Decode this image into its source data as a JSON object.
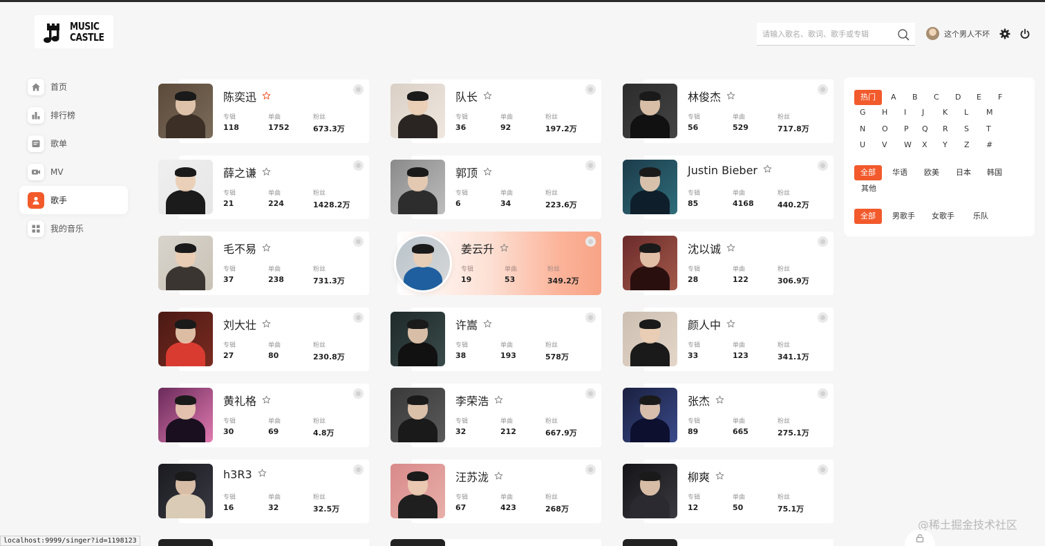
{
  "header": {
    "logo_line1": "MUSIC",
    "logo_line2": "CASTLE",
    "search_placeholder": "请输入歌名、歌词、歌手或专辑",
    "username": "这个男人不坏"
  },
  "sidebar": {
    "items": [
      {
        "label": "首页",
        "icon": "home-icon"
      },
      {
        "label": "排行榜",
        "icon": "chart-icon"
      },
      {
        "label": "歌单",
        "icon": "playlist-icon"
      },
      {
        "label": "MV",
        "icon": "video-icon"
      },
      {
        "label": "歌手",
        "icon": "singer-icon"
      },
      {
        "label": "我的音乐",
        "icon": "grid-icon"
      }
    ],
    "active_index": 4
  },
  "stat_labels": {
    "album": "专辑",
    "single": "单曲",
    "fans": "粉丝"
  },
  "singers": [
    {
      "name": "陈奕迅",
      "album": "118",
      "single": "1752",
      "fans": "673.3万",
      "starred": true
    },
    {
      "name": "队长",
      "album": "36",
      "single": "92",
      "fans": "197.2万"
    },
    {
      "name": "林俊杰",
      "album": "56",
      "single": "529",
      "fans": "717.8万"
    },
    {
      "name": "薛之谦",
      "album": "21",
      "single": "224",
      "fans": "1428.2万"
    },
    {
      "name": "郭顶",
      "album": "6",
      "single": "34",
      "fans": "223.6万"
    },
    {
      "name": "Justin Bieber",
      "album": "85",
      "single": "4168",
      "fans": "440.2万"
    },
    {
      "name": "毛不易",
      "album": "37",
      "single": "238",
      "fans": "731.3万"
    },
    {
      "name": "姜云升",
      "album": "19",
      "single": "53",
      "fans": "349.2万",
      "featured": true
    },
    {
      "name": "沈以诚",
      "album": "28",
      "single": "122",
      "fans": "306.9万"
    },
    {
      "name": "刘大壮",
      "album": "27",
      "single": "80",
      "fans": "230.8万"
    },
    {
      "name": "许嵩",
      "album": "38",
      "single": "193",
      "fans": "578万"
    },
    {
      "name": "颜人中",
      "album": "33",
      "single": "123",
      "fans": "341.1万"
    },
    {
      "name": "黄礼格",
      "album": "30",
      "single": "69",
      "fans": "4.8万"
    },
    {
      "name": "李荣浩",
      "album": "32",
      "single": "212",
      "fans": "667.9万"
    },
    {
      "name": "张杰",
      "album": "89",
      "single": "665",
      "fans": "275.1万"
    },
    {
      "name": "h3R3",
      "album": "16",
      "single": "32",
      "fans": "32.5万"
    },
    {
      "name": "汪苏泷",
      "album": "67",
      "single": "423",
      "fans": "268万"
    },
    {
      "name": "柳爽",
      "album": "12",
      "single": "50",
      "fans": "75.1万"
    }
  ],
  "filters": {
    "letters": [
      "热门",
      "A",
      "B",
      "C",
      "D",
      "E",
      "F",
      "G",
      "H",
      "I",
      "J",
      "K",
      "L",
      "M",
      "N",
      "O",
      "P",
      "Q",
      "R",
      "S",
      "T",
      "U",
      "V",
      "W",
      "X",
      "Y",
      "Z",
      "#"
    ],
    "regions": [
      "全部",
      "华语",
      "欧美",
      "日本",
      "韩国",
      "其他"
    ],
    "types": [
      "全部",
      "男歌手",
      "女歌手",
      "乐队"
    ],
    "selected": {
      "letter": "热门",
      "region": "全部",
      "type": "全部"
    }
  },
  "status_url": "localhost:9999/singer?id=1198123",
  "watermark": "@稀土掘金技术社区",
  "colors": {
    "accent": "#f25a2c",
    "background": "#f6f6f6",
    "card": "#ffffff"
  }
}
